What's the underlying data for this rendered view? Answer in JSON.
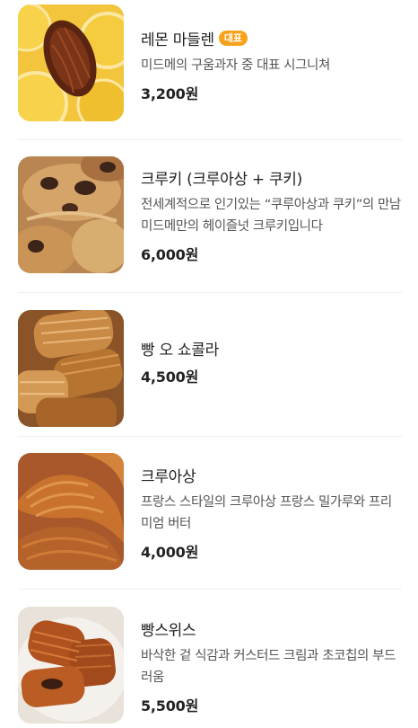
{
  "menu": {
    "items": [
      {
        "name": "레몬 마들렌",
        "badge": "대표",
        "description": "미드메의 구움과자 중 대표 시그니쳐",
        "price": "3,200원",
        "image": "madeleine-photo"
      },
      {
        "name": "크루키 (크루아상 + 쿠키)",
        "badge": "",
        "description": "전세계적으로 인기있는 “쿠루아상과 쿠키”의 만남 미드메만의 헤이즐넛 크루키입니다",
        "price": "6,000원",
        "image": "cruki-photo"
      },
      {
        "name": "빵 오 쇼콜라",
        "badge": "",
        "description": "",
        "price": "4,500원",
        "image": "pain-au-chocolat-photo"
      },
      {
        "name": "크루아상",
        "badge": "",
        "description": "프랑스 스타일의 크루아상 프랑스 밀가루와 프리미엄 버터",
        "price": "4,000원",
        "image": "croissant-photo"
      },
      {
        "name": "빵스위스",
        "badge": "",
        "description": "바삭한 겉 식감과 커스터드 크림과 초코칩의 부드러움",
        "price": "5,500원",
        "image": "pain-suisse-photo"
      }
    ]
  },
  "colors": {
    "badge": "#f7a21b",
    "divider": "#eeeeee",
    "text_primary": "#222222",
    "text_secondary": "#555555"
  }
}
